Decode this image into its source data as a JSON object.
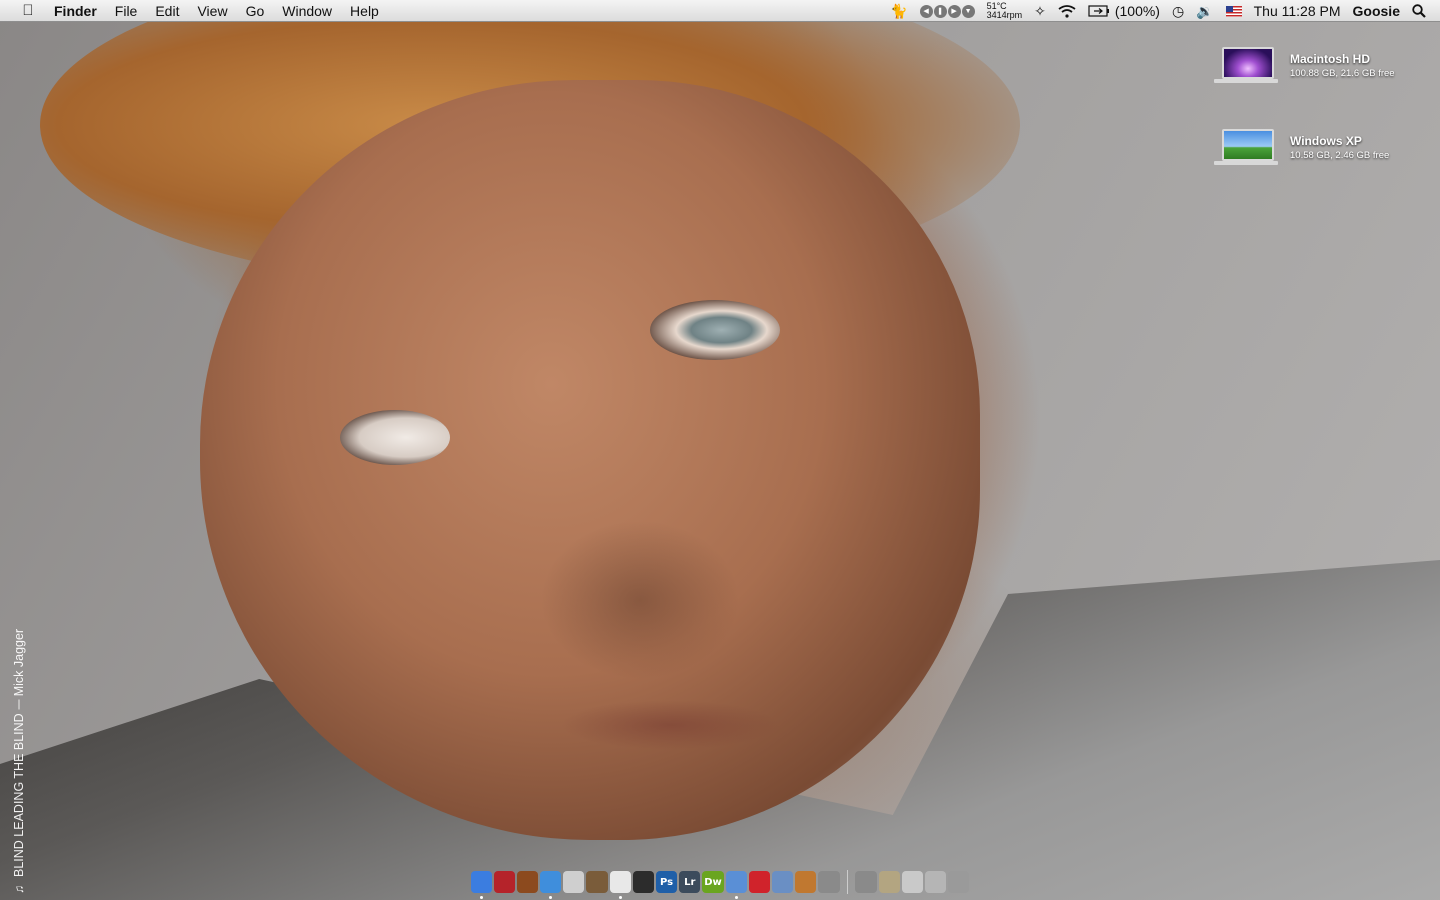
{
  "menubar": {
    "app_name": "Finder",
    "menus": [
      "File",
      "Edit",
      "View",
      "Go",
      "Window",
      "Help"
    ],
    "status": {
      "temperature": "51°C",
      "fan_speed": "3414rpm",
      "battery_percent": "(100%)",
      "datetime": "Thu 11:28 PM",
      "user": "Goosie"
    }
  },
  "desktop": {
    "drives": [
      {
        "name": "Macintosh HD",
        "info": "100.88 GB, 21.6 GB free"
      },
      {
        "name": "Windows XP",
        "info": "10.58 GB, 2.46 GB free"
      }
    ],
    "now_playing": {
      "track": "BLIND LEADING THE BLIND",
      "artist": "Mick Jagger"
    }
  },
  "dock": {
    "apps": [
      {
        "icon": "finder-icon",
        "label": "",
        "color": "#3b7de0"
      },
      {
        "icon": "address-book-icon",
        "label": "",
        "color": "#b5232a"
      },
      {
        "icon": "adium-icon",
        "label": "",
        "color": "#8c4a1e"
      },
      {
        "icon": "safari-icon",
        "label": "",
        "color": "#3f8edc"
      },
      {
        "icon": "growl-icon",
        "label": "",
        "color": "#cfcfcf"
      },
      {
        "icon": "iphoto-icon",
        "label": "",
        "color": "#7a5c3a"
      },
      {
        "icon": "flickr-uploadr-icon",
        "label": "",
        "color": "#e8e8e8"
      },
      {
        "icon": "aperture-icon",
        "label": "",
        "color": "#2c2c2c"
      },
      {
        "icon": "photoshop-icon",
        "label": "Ps",
        "color": "#1f5fa8"
      },
      {
        "icon": "lightroom-icon",
        "label": "Lr",
        "color": "#3c4b5c"
      },
      {
        "icon": "dreamweaver-icon",
        "label": "Dw",
        "color": "#6aa51f"
      },
      {
        "icon": "itunes-icon",
        "label": "",
        "color": "#5a8fd6"
      },
      {
        "icon": "lastfm-icon",
        "label": "",
        "color": "#d0232b"
      },
      {
        "icon": "xcode-icon",
        "label": "",
        "color": "#6a8fc4"
      },
      {
        "icon": "preview-icon",
        "label": "",
        "color": "#c07830"
      },
      {
        "icon": "system-preferences-icon",
        "label": "",
        "color": "#8a8a8a"
      }
    ],
    "right_items": [
      {
        "icon": "documents-stack-icon",
        "color": "#8a8a8a"
      },
      {
        "icon": "downloads-folder-icon",
        "color": "#b3a581"
      },
      {
        "icon": "applications-folder-icon",
        "color": "#c9c9c9"
      },
      {
        "icon": "printer-icon",
        "color": "#b5b5b5"
      },
      {
        "icon": "trash-icon",
        "color": "#9a9a9a"
      }
    ]
  }
}
